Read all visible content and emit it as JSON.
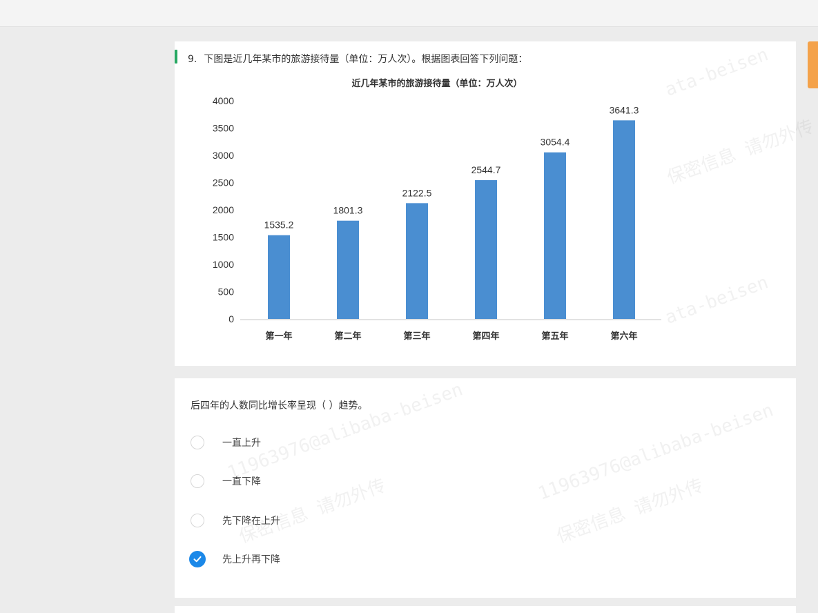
{
  "question": {
    "number": "9.",
    "title": "下图是近几年某市的旅游接待量（单位：万人次）。根据图表回答下列问题："
  },
  "stem": "后四年的人数同比增长率呈现（ ）趋势。",
  "options": [
    {
      "label": "一直上升",
      "selected": false
    },
    {
      "label": "一直下降",
      "selected": false
    },
    {
      "label": "先下降在上升",
      "selected": false
    },
    {
      "label": "先上升再下降",
      "selected": true
    }
  ],
  "colors": {
    "bar": "#4a8ed1",
    "accent": "#27a862",
    "selected": "#1b88e8",
    "side_tab": "#f4a24a"
  },
  "icons": {
    "selected": "check-icon"
  },
  "chart_data": {
    "type": "bar",
    "title": "近几年某市的旅游接待量（单位：万人次）",
    "categories": [
      "第一年",
      "第二年",
      "第三年",
      "第四年",
      "第五年",
      "第六年"
    ],
    "values": [
      1535.2,
      1801.3,
      2122.5,
      2544.7,
      3054.4,
      3641.3
    ],
    "value_labels": [
      "1535.2",
      "1801.3",
      "2122.5",
      "2544.7",
      "3054.4",
      "3641.3"
    ],
    "yticks": [
      "0",
      "500",
      "1000",
      "1500",
      "2000",
      "2500",
      "3000",
      "3500",
      "4000"
    ],
    "ylim": [
      0,
      4000
    ],
    "xlabel": "",
    "ylabel": "",
    "grid": false,
    "legend": "none"
  },
  "watermark": {
    "lines": [
      "11963976@alibaba-beisen",
      "保密信息 请勿外传",
      "ata-beisen"
    ]
  }
}
